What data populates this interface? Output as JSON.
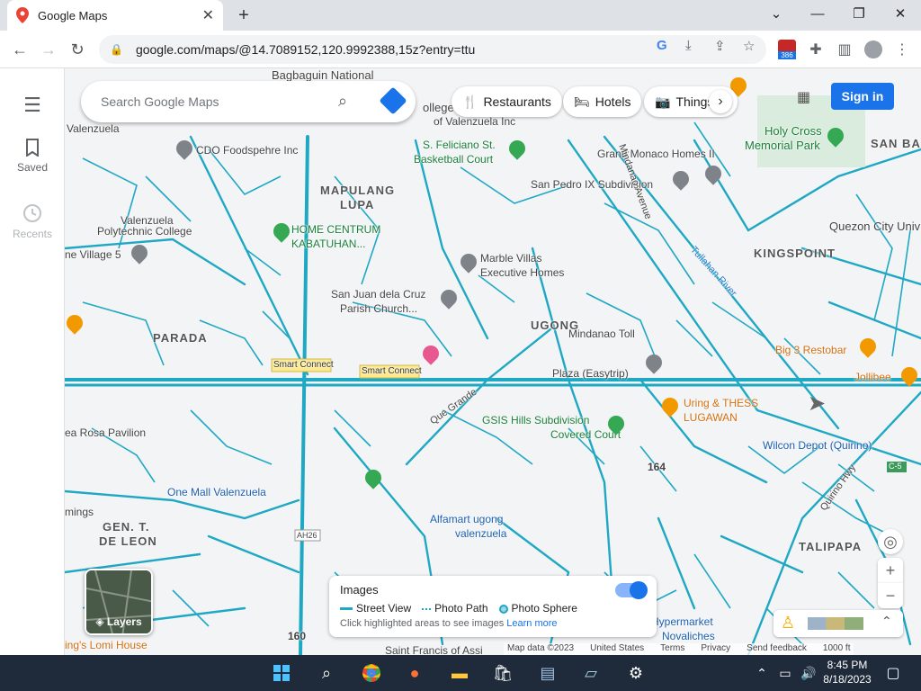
{
  "browser": {
    "tab_title": "Google Maps",
    "tab_close": "✕",
    "new_tab": "+",
    "url": "google.com/maps/@14.7089152,120.9992388,15z?entry=ttu",
    "window_controls": {
      "chevron": "⌄",
      "minimize": "—",
      "restore": "❐",
      "close": "✕"
    },
    "extension_badge": "386"
  },
  "rail": {
    "menu_icon": "☰",
    "saved_label": "Saved",
    "recents_label": "Recents"
  },
  "search": {
    "placeholder": "Search Google Maps"
  },
  "chips": [
    {
      "label": "Restaurants",
      "icon": "🍴"
    },
    {
      "label": "Hotels",
      "icon": "🛏"
    },
    {
      "label": "Things",
      "icon": "📷"
    }
  ],
  "signin_label": "Sign in",
  "map_labels": {
    "bagbaguin": "Bagbaguin National",
    "college_inc": "ollege Inc",
    "of_valenzuela": "of Valenzuela Inc",
    "valenzuela_top": "Valenzuela",
    "cdo": "CDO Foodspehre Inc",
    "mapulang": "MAPULANG",
    "lupa": "LUPA",
    "feliciano": "S. Feliciano St.",
    "basketball": "Basketball Court",
    "grand_monaco": "Grand Monaco Homes II",
    "san_pedro": "San Pedro IX Subdivision",
    "holy_cross": "Holy Cross",
    "memorial_park": "Memorial Park",
    "san_ba": "SAN BA",
    "valenzuela_poly": "Valenzuela",
    "polytechnic": "Polytechnic College",
    "home_centrum": "HOME CENTRUM",
    "kabatuhan": "KABATUHAN...",
    "village5": "ne Village 5",
    "marble_villas": "Marble Villas",
    "executive_homes": "Executive Homes",
    "kingspoint": "KINGSPOINT",
    "quezon_city": "Quezon City Univ",
    "san_juan": "San Juan dela Cruz",
    "parish": "Parish Church...",
    "parada": "PARADA",
    "ugong": "UGONG",
    "big3": "Big 3 Restobar",
    "mindanao_toll": "Mindanao Toll",
    "plaza": "Plaza (Easytrip)",
    "jollibee": "Jollibee",
    "smart_connect_1": "Smart Connect",
    "smart_connect_2": "Smart Connect",
    "uring": "Uring & THESS",
    "lugawan": "LUGAWAN",
    "gsis": "GSIS Hills Subdivision",
    "covered_court": "Covered Court",
    "wilcon": "Wilcon Depot (Quirino)",
    "pavilion": "ea Rosa Pavilion",
    "one_mall": "One Mall Valenzuela",
    "num164": "164",
    "alfamart": "Alfamart ugong",
    "alfamart2": "valenzuela",
    "gen_t": "GEN. T.",
    "de_leon": "DE LEON",
    "talipapa": "TALIPAPA",
    "hypermarket": "Hypermarket",
    "novaliches": "Novaliches",
    "lomi": "ing's Lomi House",
    "num160": "160",
    "saint_francis": "Saint Francis of Assi",
    "road_que_grande": "Que Grande",
    "road_mindanao": "Mindanao Avenue",
    "road_tullahan": "Tullahan River",
    "road_quirino": "Quirino Hwy",
    "ah26": "AH26",
    "c5": "C-5",
    "mings": "mings"
  },
  "layers_label": "Layers",
  "images_panel": {
    "title": "Images",
    "street_view": "Street View",
    "photo_path": "Photo Path",
    "photo_sphere": "Photo Sphere",
    "hint": "Click highlighted areas to see images",
    "learn_more": "Learn more"
  },
  "attribution": {
    "map_data": "Map data ©2023",
    "country": "United States",
    "terms": "Terms",
    "privacy": "Privacy",
    "feedback": "Send feedback",
    "scale": "1000 ft"
  },
  "zoom": {
    "in": "+",
    "out": "−"
  },
  "taskbar": {
    "time": "8:45 PM",
    "date": "8/18/2023"
  },
  "colors": {
    "street_view_line": "#1fa8c4",
    "accent_blue": "#1a73e8",
    "map_bg": "#f3f4f6"
  }
}
